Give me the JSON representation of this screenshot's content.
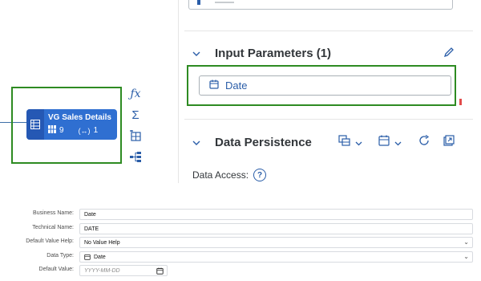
{
  "node": {
    "title": "VG Sales Details",
    "column_count": "9",
    "param_count": "1",
    "icon": "table-icon",
    "color": "#2f6fd1"
  },
  "tools": [
    {
      "name": "fx-icon",
      "glyph": "ƒx"
    },
    {
      "name": "sigma-icon",
      "glyph": "Σ"
    },
    {
      "name": "table-plus-icon",
      "glyph": "⊞"
    },
    {
      "name": "share-nodes-icon",
      "glyph": "⋔"
    }
  ],
  "input_parameters": {
    "title": "Input Parameters (1)",
    "items": [
      {
        "label": "Date"
      }
    ]
  },
  "data_persistence": {
    "title": "Data Persistence",
    "data_access_label": "Data Access:"
  },
  "form": {
    "business_name": {
      "label": "Business Name:",
      "value": "Date"
    },
    "technical_name": {
      "label": "Technical Name:",
      "value": "DATE"
    },
    "default_value_help": {
      "label": "Default Value Help:",
      "value": "No Value Help"
    },
    "data_type": {
      "label": "Data Type:",
      "value": "Date"
    },
    "default_value": {
      "label": "Default Value:",
      "placeholder": "YYYY-MM-DD"
    }
  },
  "colors": {
    "highlight": "#2e8b22",
    "accent": "#2a5da8",
    "node": "#2f6fd1"
  }
}
